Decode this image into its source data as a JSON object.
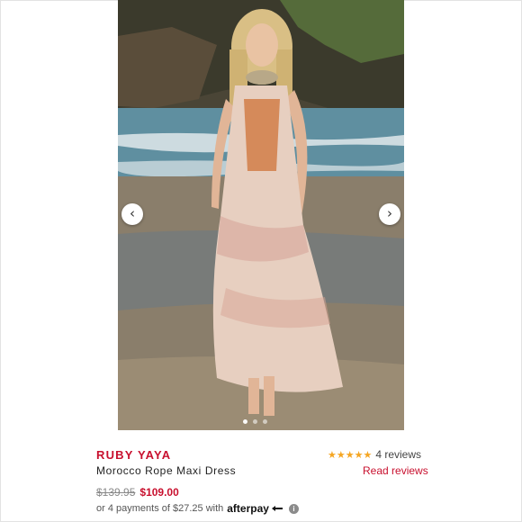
{
  "product": {
    "brand": "RUBY YAYA",
    "name": "Morocco Rope Maxi Dress",
    "original_price": "$139.95",
    "sale_price": "$109.00"
  },
  "rating": {
    "stars": "★★★★★",
    "reviews_count": "4 reviews",
    "read_reviews_label": "Read reviews"
  },
  "afterpay": {
    "text": "or 4 payments of $27.25 with",
    "brand": "afterpay",
    "info_icon": "i"
  },
  "carousel": {
    "prev_icon": "‹",
    "next_icon": "›",
    "slide_count": 3,
    "active_index": 0
  },
  "colors": {
    "brand_red": "#c8102e",
    "star_gold": "#f5a623"
  }
}
